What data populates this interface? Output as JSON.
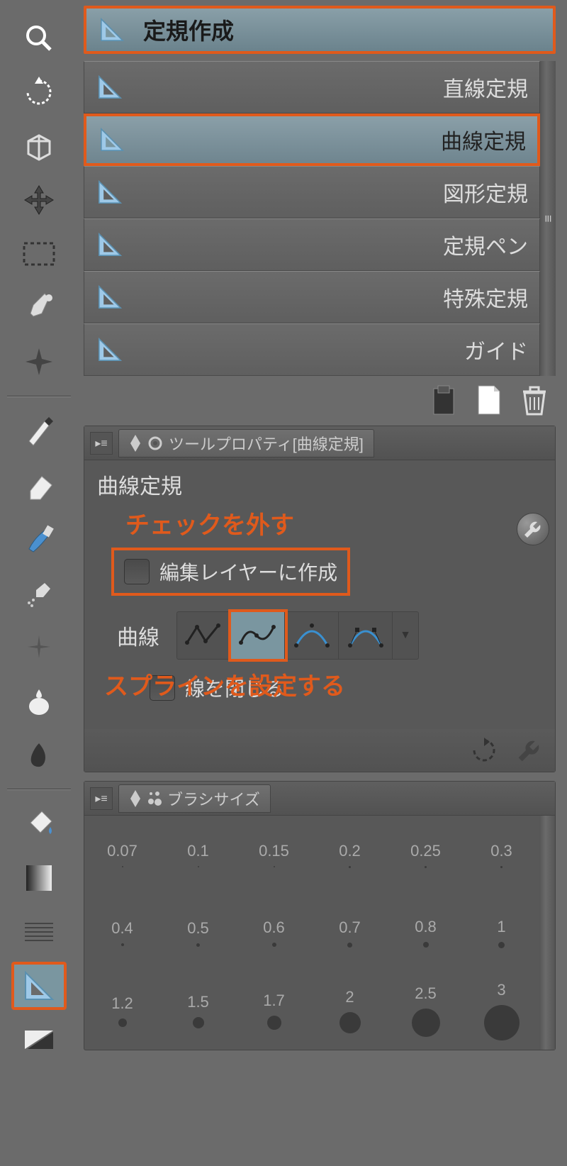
{
  "toolbar": {
    "icons": [
      "zoom",
      "rotate-view",
      "perspective",
      "move-arrows",
      "marquee",
      "eyedropper",
      "sparkle"
    ],
    "icons2": [
      "pen",
      "eraser",
      "brush",
      "airbrush",
      "plus-dodge",
      "blend-drop",
      "smudge"
    ],
    "icons3": [
      "fill-bucket",
      "gradient",
      "pattern",
      "ruler",
      "divide"
    ]
  },
  "group": {
    "title": "定規作成"
  },
  "subtools": [
    {
      "label": "直線定規"
    },
    {
      "label": "曲線定規",
      "selected": true
    },
    {
      "label": "図形定規"
    },
    {
      "label": "定規ペン"
    },
    {
      "label": "特殊定規"
    },
    {
      "label": "ガイド"
    }
  ],
  "property": {
    "tab_label": "ツールプロパティ[曲線定規]",
    "title": "曲線定規",
    "annotation1": "チェックを外す",
    "checkbox1": "編集レイヤーに作成",
    "curve_label": "曲線",
    "checkbox2": "線を閉じる",
    "annotation2": "スプラインを設定する"
  },
  "brush": {
    "tab_label": "ブラシサイズ",
    "sizes": [
      {
        "v": "0.07",
        "d": 2
      },
      {
        "v": "0.1",
        "d": 2
      },
      {
        "v": "0.15",
        "d": 2
      },
      {
        "v": "0.2",
        "d": 3
      },
      {
        "v": "0.25",
        "d": 3
      },
      {
        "v": "0.3",
        "d": 3
      },
      {
        "v": "0.4",
        "d": 4
      },
      {
        "v": "0.5",
        "d": 5
      },
      {
        "v": "0.6",
        "d": 6
      },
      {
        "v": "0.7",
        "d": 7
      },
      {
        "v": "0.8",
        "d": 8
      },
      {
        "v": "1",
        "d": 9
      },
      {
        "v": "1.2",
        "d": 12
      },
      {
        "v": "1.5",
        "d": 16
      },
      {
        "v": "1.7",
        "d": 20
      },
      {
        "v": "2",
        "d": 30
      },
      {
        "v": "2.5",
        "d": 40
      },
      {
        "v": "3",
        "d": 50
      }
    ]
  }
}
